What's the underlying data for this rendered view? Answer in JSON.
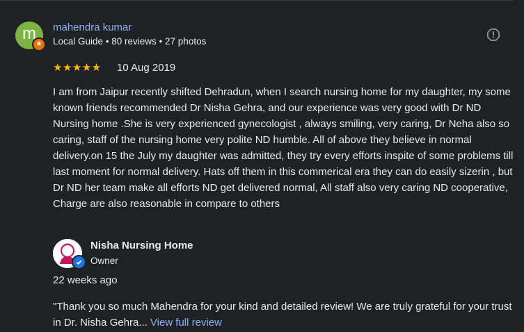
{
  "review": {
    "author": {
      "initial": "m",
      "name": "mahendra kumar",
      "meta": "Local Guide • 80 reviews • 27 photos",
      "avatar_color": "#7cb342"
    },
    "rating": 5,
    "stars": "★★★★★",
    "date": "10 Aug 2019",
    "text": "I am from Jaipur recently shifted Dehradun, when I search nursing home for my daughter, my some known friends recommended Dr Nisha Gehra, and our experience was very good with Dr ND Nursing home .She is very experienced gynecologist , always smiling, very caring, Dr Neha also so caring, staff of the nursing home very polite ND humble. All of above they believe in normal delivery.on 15 the July my daughter was admitted, they try every efforts inspite of some problems till last moment for normal delivery. Hats off them in this commerical era they can do easily sizerin , but Dr ND her team make all efforts ND get delivered normal, All staff also very caring ND cooperative, Charge are also reasonable in compare to others"
  },
  "owner_response": {
    "name": "Nisha Nursing Home",
    "role": "Owner",
    "time": "22 weeks ago",
    "text": "\"Thank you so much Mahendra for your kind and detailed review! We are truly grateful for your trust in Dr. Nisha Gehra...",
    "view_full_label": "View full review"
  },
  "icons": {
    "report": "report-icon",
    "local_guide": "local-guide-star-icon",
    "verified": "verified-check-icon"
  },
  "colors": {
    "background": "#202124",
    "link": "#8ab4f8",
    "star": "#fbbc04",
    "text": "#e8eaed"
  }
}
